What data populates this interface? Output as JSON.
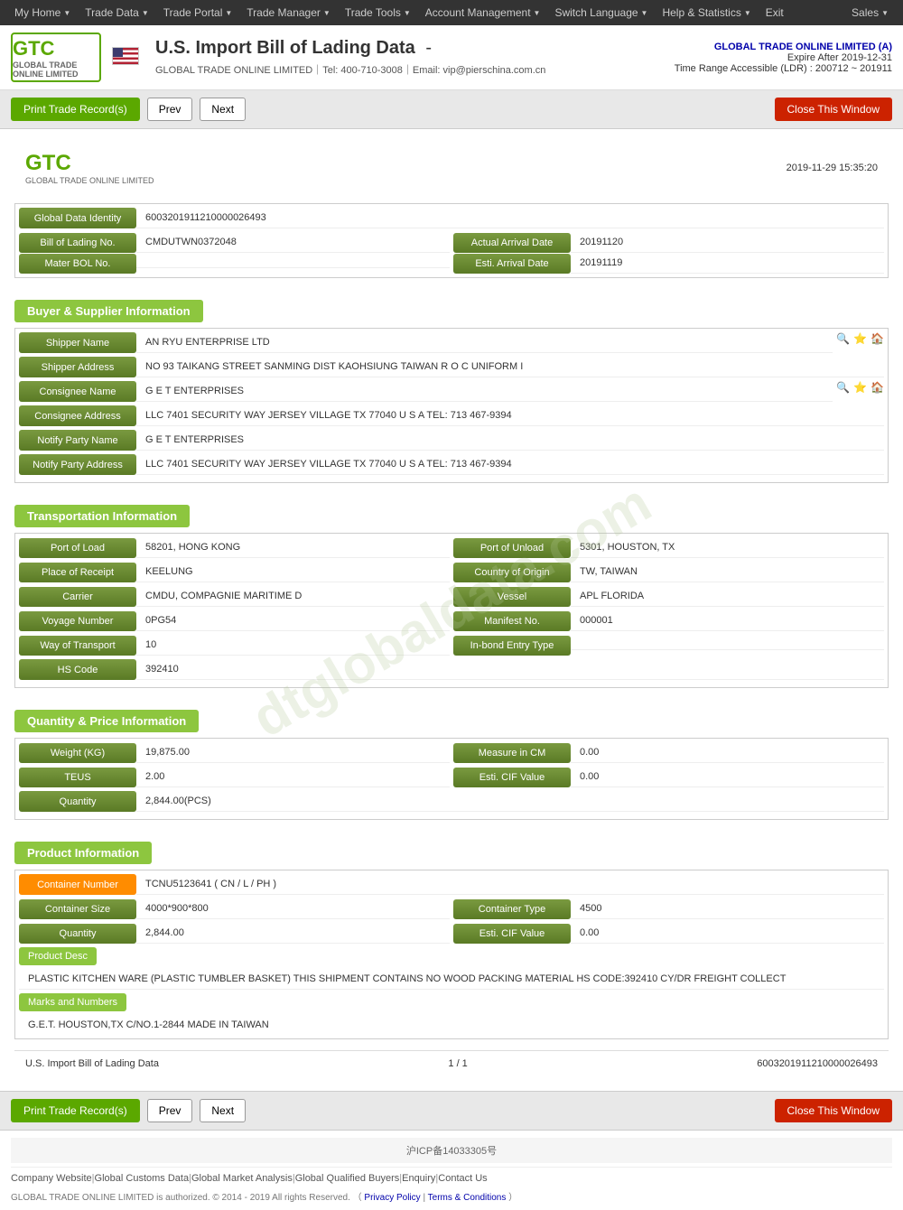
{
  "nav": {
    "items": [
      {
        "label": "My Home",
        "hasArrow": true
      },
      {
        "label": "Trade Data",
        "hasArrow": true
      },
      {
        "label": "Trade Portal",
        "hasArrow": true
      },
      {
        "label": "Trade Manager",
        "hasArrow": true
      },
      {
        "label": "Trade Tools",
        "hasArrow": true
      },
      {
        "label": "Account Management",
        "hasArrow": true
      },
      {
        "label": "Switch Language",
        "hasArrow": true
      },
      {
        "label": "Help & Statistics",
        "hasArrow": true
      },
      {
        "label": "Exit",
        "hasArrow": false
      }
    ],
    "sales_label": "Sales"
  },
  "header": {
    "logo_text": "GTC",
    "logo_subtitle": "GLOBAL TRADE ONLINE LIMITED",
    "page_title": "U.S. Import Bill of Lading Data",
    "page_title_dash": "-",
    "company_line": "GLOBAL TRADE ONLINE LIMITED｜Tel: 400-710-3008｜Email: vip@pierschina.com.cn",
    "account_name": "GLOBAL TRADE ONLINE LIMITED (A)",
    "expire": "Expire After 2019-12-31",
    "ldr": "Time Range Accessible (LDR) : 200712 ~ 201911"
  },
  "buttons": {
    "print": "Print Trade Record(s)",
    "prev": "Prev",
    "next": "Next",
    "close": "Close This Window"
  },
  "doc": {
    "datetime": "2019-11-29 15:35:20",
    "global_data_identity": "6003201911210000026493",
    "bill_of_lading_no": "CMDUTWN0372048",
    "actual_arrival_date": "20191120",
    "mater_bol_no": "",
    "esti_arrival_date": "20191119"
  },
  "buyer_supplier": {
    "section_title": "Buyer & Supplier Information",
    "shipper_name_label": "Shipper Name",
    "shipper_name_value": "AN RYU ENTERPRISE LTD",
    "shipper_address_label": "Shipper Address",
    "shipper_address_value": "NO 93 TAIKANG STREET SANMING DIST KAOHSIUNG TAIWAN R O C UNIFORM I",
    "consignee_name_label": "Consignee Name",
    "consignee_name_value": "G E T ENTERPRISES",
    "consignee_address_label": "Consignee Address",
    "consignee_address_value": "LLC 7401 SECURITY WAY JERSEY VILLAGE TX 77040 U S A TEL: 713 467-9394",
    "notify_party_name_label": "Notify Party Name",
    "notify_party_name_value": "G E T ENTERPRISES",
    "notify_party_address_label": "Notify Party Address",
    "notify_party_address_value": "LLC 7401 SECURITY WAY JERSEY VILLAGE TX 77040 U S A TEL: 713 467-9394"
  },
  "transportation": {
    "section_title": "Transportation Information",
    "port_of_load_label": "Port of Load",
    "port_of_load_value": "58201, HONG KONG",
    "port_of_unload_label": "Port of Unload",
    "port_of_unload_value": "5301, HOUSTON, TX",
    "place_of_receipt_label": "Place of Receipt",
    "place_of_receipt_value": "KEELUNG",
    "country_of_origin_label": "Country of Origin",
    "country_of_origin_value": "TW, TAIWAN",
    "carrier_label": "Carrier",
    "carrier_value": "CMDU, COMPAGNIE MARITIME D",
    "vessel_label": "Vessel",
    "vessel_value": "APL FLORIDA",
    "voyage_number_label": "Voyage Number",
    "voyage_number_value": "0PG54",
    "manifest_no_label": "Manifest No.",
    "manifest_no_value": "000001",
    "way_of_transport_label": "Way of Transport",
    "way_of_transport_value": "10",
    "inbond_entry_type_label": "In-bond Entry Type",
    "inbond_entry_type_value": "",
    "hs_code_label": "HS Code",
    "hs_code_value": "392410"
  },
  "quantity_price": {
    "section_title": "Quantity & Price Information",
    "weight_label": "Weight (KG)",
    "weight_value": "19,875.00",
    "measure_in_cm_label": "Measure in CM",
    "measure_in_cm_value": "0.00",
    "teus_label": "TEUS",
    "teus_value": "2.00",
    "esti_cif_value_label": "Esti. CIF Value",
    "esti_cif_value_1": "0.00",
    "quantity_label": "Quantity",
    "quantity_value": "2,844.00(PCS)"
  },
  "product_info": {
    "section_title": "Product Information",
    "container_number_label": "Container Number",
    "container_number_value": "TCNU5123641 ( CN / L / PH )",
    "container_size_label": "Container Size",
    "container_size_value": "4000*900*800",
    "container_type_label": "Container Type",
    "container_type_value": "4500",
    "quantity_label": "Quantity",
    "quantity_value": "2,844.00",
    "esti_cif_value_label": "Esti. CIF Value",
    "esti_cif_value": "0.00",
    "product_desc_label": "Product Desc",
    "product_desc_value": "PLASTIC KITCHEN WARE (PLASTIC TUMBLER BASKET) THIS SHIPMENT CONTAINS NO WOOD PACKING MATERIAL HS CODE:392410 CY/DR FREIGHT COLLECT",
    "marks_and_numbers_label": "Marks and Numbers",
    "marks_and_numbers_value": "G.E.T. HOUSTON,TX C/NO.1-2844 MADE IN TAIWAN"
  },
  "footer": {
    "doc_type": "U.S. Import Bill of Lading Data",
    "pagination": "1 / 1",
    "record_id": "6003201911210000026493"
  },
  "bottom_footer": {
    "beian": "沪ICP备14033305号",
    "links": [
      "Company Website",
      "Global Customs Data",
      "Global Market Analysis",
      "Global Qualified Buyers",
      "Enquiry",
      "Contact Us"
    ],
    "copyright": "GLOBAL TRADE ONLINE LIMITED is authorized. © 2014 - 2019 All rights Reserved.  （",
    "privacy_policy": "Privacy Policy",
    "separator": "|",
    "terms": "Terms & Conditions",
    "close_bracket": "）"
  },
  "watermark": "dtglobaldata.com"
}
